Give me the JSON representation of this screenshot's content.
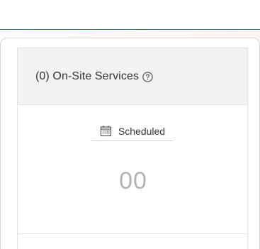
{
  "services_card": {
    "title": "(0) On-Site Services",
    "help_icon": "question-circle-icon",
    "scheduled": {
      "icon": "calendar-icon",
      "label": "Scheduled",
      "count": "00"
    }
  },
  "colors": {
    "accent_line": "#2f6aa3",
    "header_bg": "#f2f2f2",
    "count_text": "#b3b3b3"
  }
}
